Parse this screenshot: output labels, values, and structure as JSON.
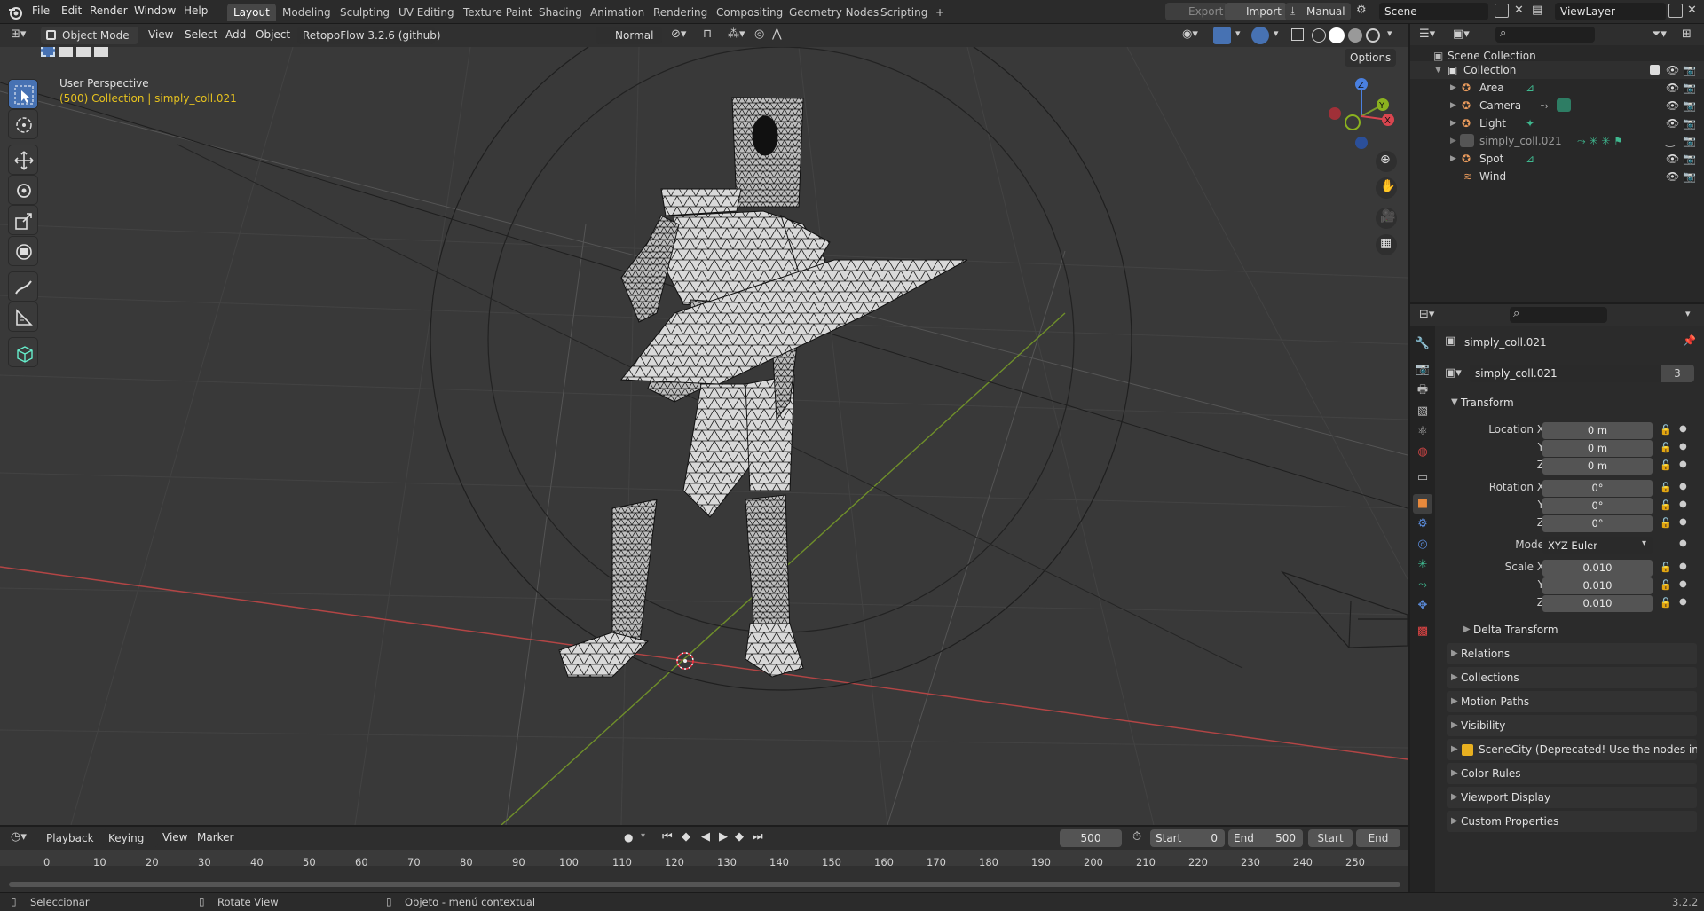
{
  "topbar": {
    "menu": [
      "File",
      "Edit",
      "Render",
      "Window",
      "Help"
    ],
    "workspaces": [
      "Layout",
      "Modeling",
      "Sculpting",
      "UV Editing",
      "Texture Paint",
      "Shading",
      "Animation",
      "Rendering",
      "Compositing",
      "Geometry Nodes",
      "Scripting"
    ],
    "active_workspace": "Layout",
    "add_workspace": "+",
    "export_label": "Export",
    "import_label": "Import",
    "manual_label": "Manual",
    "scene_name": "Scene",
    "view_layer": "ViewLayer"
  },
  "viewport_header": {
    "mode": "Object Mode",
    "view": "View",
    "select": "Select",
    "add": "Add",
    "object": "Object",
    "addon": "RetopoFlow 3.2.6 (github)",
    "orientation": "Normal",
    "options": "Options"
  },
  "viewport": {
    "perspective": "User Perspective",
    "collection_info": "(500) Collection | simply_coll.021",
    "gizmo": {
      "z": "Z",
      "y": "Y",
      "x": "X"
    }
  },
  "outliner": {
    "root": "Scene Collection",
    "collection": "Collection",
    "items": [
      {
        "name": "Area",
        "icon": "area-light-icon"
      },
      {
        "name": "Camera",
        "icon": "camera-icon"
      },
      {
        "name": "Light",
        "icon": "point-light-icon"
      },
      {
        "name": "simply_coll.021",
        "icon": "armature-icon"
      },
      {
        "name": "Spot",
        "icon": "spot-light-icon"
      },
      {
        "name": "Wind",
        "icon": "wind-icon"
      }
    ]
  },
  "properties": {
    "object_name": "simply_coll.021",
    "data_name": "simply_coll.021",
    "users": "3",
    "transform_label": "Transform",
    "location": {
      "label_x": "Location X",
      "label_y": "Y",
      "label_z": "Z",
      "x": "0 m",
      "y": "0 m",
      "z": "0 m"
    },
    "rotation": {
      "label_x": "Rotation X",
      "label_y": "Y",
      "label_z": "Z",
      "x": "0°",
      "y": "0°",
      "z": "0°"
    },
    "mode_label": "Mode",
    "mode_value": "XYZ Euler",
    "scale": {
      "label_x": "Scale X",
      "label_y": "Y",
      "label_z": "Z",
      "x": "0.010",
      "y": "0.010",
      "z": "0.010"
    },
    "delta_transform": "Delta Transform",
    "panels": [
      "Relations",
      "Collections",
      "Motion Paths",
      "Visibility",
      "SceneCity (Deprecated! Use the nodes instead)",
      "Color Rules",
      "Viewport Display",
      "Custom Properties"
    ]
  },
  "timeline": {
    "playback": "Playback",
    "keying": "Keying",
    "view": "View",
    "marker": "Marker",
    "current_frame": "500",
    "start_label": "Start",
    "start_value": "0",
    "end_label": "End",
    "end_value": "500",
    "start_btn": "Start",
    "end_btn": "End",
    "ticks": [
      "0",
      "10",
      "20",
      "30",
      "40",
      "50",
      "60",
      "70",
      "80",
      "90",
      "100",
      "110",
      "120",
      "130",
      "140",
      "150",
      "160",
      "170",
      "180",
      "190",
      "200",
      "210",
      "220",
      "230",
      "240",
      "250"
    ]
  },
  "statusbar": {
    "select": "Seleccionar",
    "rotate": "Rotate View",
    "context": "Objeto - menú contextual",
    "version": "3.2.2"
  }
}
